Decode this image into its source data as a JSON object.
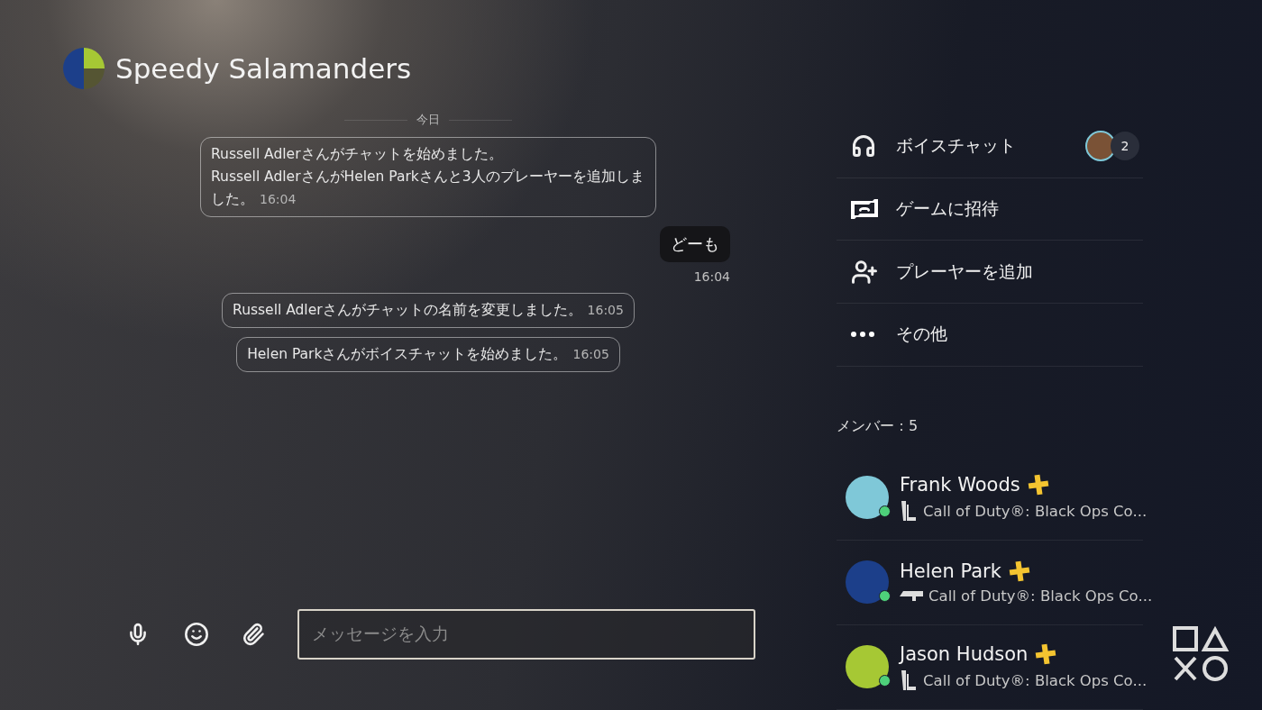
{
  "conversation": {
    "title": "Speedy Salamanders"
  },
  "messages": [
    {
      "kind": "date",
      "text": "今日"
    },
    {
      "kind": "system",
      "lines": [
        "Russell Adlerさんがチャットを始めました。",
        "Russell AdlerさんがHelen Parkさんと3人のプレーヤーを追加しました。"
      ],
      "time": "16:04"
    },
    {
      "kind": "own",
      "text": "どーも",
      "time": "16:04"
    },
    {
      "kind": "system",
      "lines": [
        "Russell Adlerさんがチャットの名前を変更しました。"
      ],
      "time": "16:05"
    },
    {
      "kind": "system",
      "lines": [
        "Helen Parkさんがボイスチャットを始めました。"
      ],
      "time": "16:05"
    }
  ],
  "composer": {
    "placeholder": "メッセージを入力"
  },
  "actions": [
    {
      "kind": "voice",
      "label": "ボイスチャット",
      "count": "2"
    },
    {
      "kind": "invite",
      "label": "ゲームに招待"
    },
    {
      "kind": "add",
      "label": "プレーヤーを追加"
    },
    {
      "kind": "more",
      "label": "その他"
    }
  ],
  "members_header": "メンバー：5",
  "members": [
    {
      "name": "Frank Woods",
      "plus": true,
      "online": true,
      "kind": "upright",
      "game": "Call of Duty®: Black Ops Co...",
      "color": "#7fc8d8"
    },
    {
      "name": "Helen Park",
      "plus": true,
      "online": true,
      "kind": "flat",
      "game": "Call of Duty®: Black Ops Co...",
      "color": "#1c3f8a"
    },
    {
      "name": "Jason Hudson",
      "plus": true,
      "online": true,
      "kind": "upright",
      "game": "Call of Duty®: Black Ops Co...",
      "color": "#a6c834"
    }
  ]
}
